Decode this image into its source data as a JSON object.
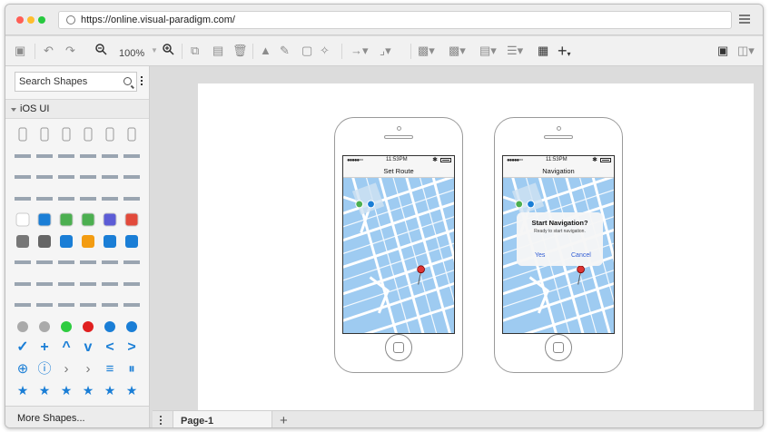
{
  "window": {
    "url": "https://online.visual-paradigm.com/",
    "traffic_colors": [
      "#ff5f56",
      "#ffbd2e",
      "#27c93f"
    ]
  },
  "toolbar": {
    "zoom_label": "100%"
  },
  "sidebar": {
    "search_placeholder": "Search Shapes",
    "category_label": "iOS UI",
    "more_shapes_label": "More Shapes..."
  },
  "pages": {
    "tabs": [
      "Page-1"
    ]
  },
  "phones": [
    {
      "status_time": "11:53PM",
      "nav_title": "Set Route",
      "pin_color": "#d33",
      "show_dialog": false
    },
    {
      "status_time": "11:53PM",
      "nav_title": "Navigation",
      "pin_color": "#d33",
      "show_dialog": true
    }
  ],
  "dialog": {
    "title": "Start Navigation?",
    "message": "Ready to start navigation.",
    "confirm_label": "Yes",
    "cancel_label": "Cancel"
  },
  "colors": {
    "accent_blue": "#1a7ed6",
    "map_water": "#9ecbf1",
    "map_road": "#ffffff",
    "route_start": "#4caf50"
  }
}
